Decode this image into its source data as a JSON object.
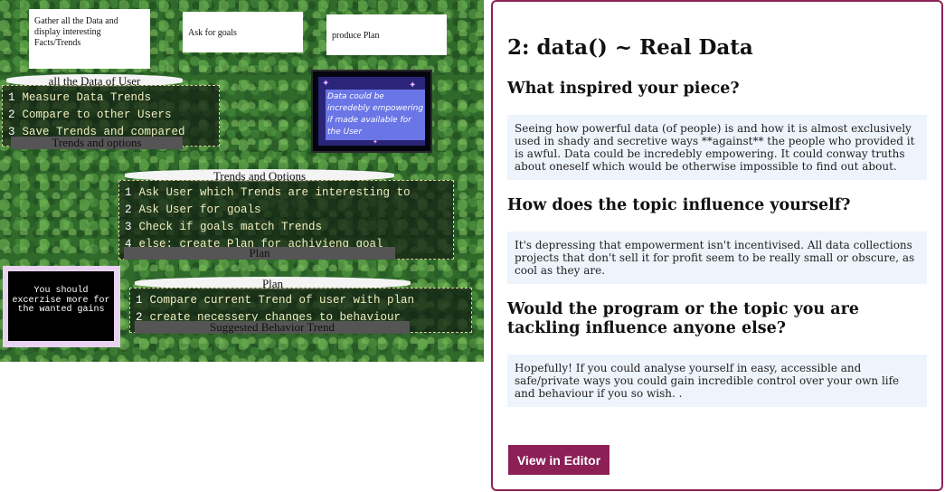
{
  "canvas": {
    "notes": [
      "Gather all the Data and display interesting Facts/Trends",
      "Ask for goals",
      "produce Plan"
    ],
    "block1": {
      "header": "all the Data of User",
      "lines": [
        "Measure Data Trends",
        "Compare to other Users",
        "Save Trends and compared"
      ],
      "footer": "Trends and options"
    },
    "star_note": "Data could be incredebly empowering if made available for the User",
    "block2": {
      "header": "Trends and Options",
      "lines": [
        "Ask User which Trends are interesting to",
        "Ask User for goals",
        "Check if goals match Trends",
        "else: create Plan for achivieng goal"
      ],
      "footer": "Plan"
    },
    "block3": {
      "header": "Plan",
      "lines": [
        "Compare current Trend of user with plan",
        "create necessery changes to behaviour"
      ],
      "footer": "Suggested Behavior Trend"
    },
    "black_note": "You should excerzise more for the wanted gains"
  },
  "panel": {
    "title": "2: data() ~ Real Data",
    "q1": "What inspired your piece?",
    "a1": "Seeing how powerful data (of people) is and how it is almost exclusively used in shady and secretive ways **against** the people who provided it is awful. Data could be incredebly empowering. It could conway truths about oneself which would be otherwise impossible to find out about.",
    "q2": "How does the topic influence yourself?",
    "a2": "It's depressing that empowerment isn't incentivised. All data collections projects that don't sell it for profit seem to be really small or obscure, as cool as they are.",
    "q3": "Would the program or the topic you are tackling influence anyone else?",
    "a3": "Hopefully! If you could analyse yourself in easy, accessible and safe/private ways you could gain incredible control over your own life and behaviour if you so wish. .",
    "button": "View in Editor"
  }
}
